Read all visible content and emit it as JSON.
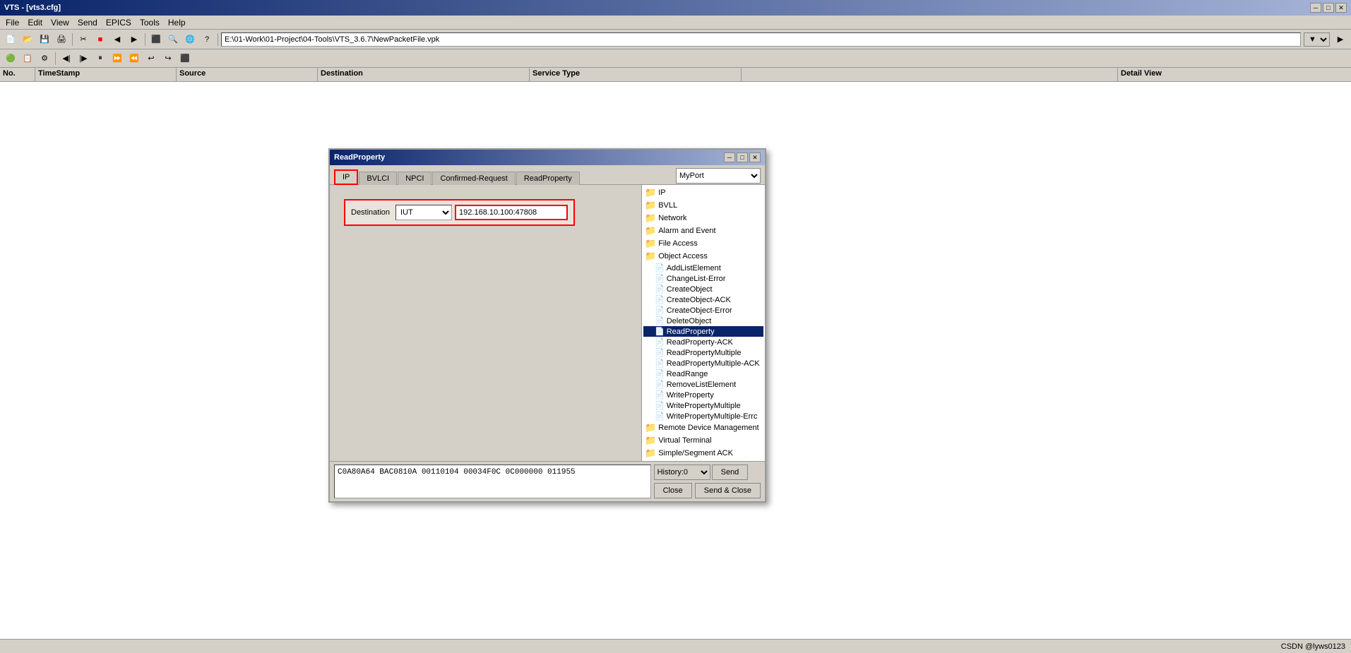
{
  "app": {
    "title": "VTS - [vts3.cfg]",
    "watermark": "CSDN @lyws0123"
  },
  "menu": {
    "items": [
      "File",
      "Edit",
      "View",
      "Send",
      "EPICS",
      "Tools",
      "Help"
    ]
  },
  "address_bar": {
    "path": "E:\\01-Work\\01-Project\\04-Tools\\VTS_3.6.7\\NewPacketFile.vpk"
  },
  "table": {
    "columns": [
      "No.",
      "TimeStamp",
      "Source",
      "Destination",
      "Service Type",
      "",
      "Detail View"
    ]
  },
  "dialog": {
    "title": "ReadProperty",
    "tabs": [
      "IP",
      "BVLCI",
      "NPCI",
      "Confirmed-Request",
      "ReadProperty"
    ],
    "active_tab": "IP",
    "destination": {
      "label": "Destination",
      "type": "IUT",
      "ip": "192.168.10.100:47808"
    },
    "port_select": "MyPort",
    "hex_content": "C0A80A64 BAC0810A 00110104 00034F0C 0C000000\n011955",
    "tree": {
      "items": [
        {
          "label": "IP",
          "type": "folder",
          "level": 0
        },
        {
          "label": "BVLL",
          "type": "folder",
          "level": 0
        },
        {
          "label": "Network",
          "type": "folder",
          "level": 0
        },
        {
          "label": "Alarm and Event",
          "type": "folder",
          "level": 0
        },
        {
          "label": "File Access",
          "type": "folder",
          "level": 0
        },
        {
          "label": "Object Access",
          "type": "folder",
          "level": 0,
          "expanded": true
        },
        {
          "label": "AddListElement",
          "type": "item",
          "level": 1
        },
        {
          "label": "ChangeList-Error",
          "type": "item",
          "level": 1
        },
        {
          "label": "CreateObject",
          "type": "item",
          "level": 1
        },
        {
          "label": "CreateObject-ACK",
          "type": "item",
          "level": 1
        },
        {
          "label": "CreateObject-Error",
          "type": "item",
          "level": 1
        },
        {
          "label": "DeleteObject",
          "type": "item",
          "level": 1
        },
        {
          "label": "ReadProperty",
          "type": "item",
          "level": 1,
          "selected": true
        },
        {
          "label": "ReadProperty-ACK",
          "type": "item",
          "level": 1
        },
        {
          "label": "ReadPropertyMultiple",
          "type": "item",
          "level": 1
        },
        {
          "label": "ReadPropertyMultiple-ACK",
          "type": "item",
          "level": 1
        },
        {
          "label": "ReadRange",
          "type": "item",
          "level": 1
        },
        {
          "label": "RemoveListElement",
          "type": "item",
          "level": 1
        },
        {
          "label": "WriteProperty",
          "type": "item",
          "level": 1
        },
        {
          "label": "WritePropertyMultiple",
          "type": "item",
          "level": 1
        },
        {
          "label": "WritePropertyMultiple-Errc",
          "type": "item",
          "level": 1
        },
        {
          "label": "Remote Device Management",
          "type": "folder",
          "level": 0
        },
        {
          "label": "Virtual Terminal",
          "type": "folder",
          "level": 0
        },
        {
          "label": "Simple/Segment ACK",
          "type": "folder",
          "level": 0
        }
      ]
    },
    "history": "History:0",
    "buttons": {
      "send": "Send",
      "close": "Close",
      "send_close": "Send & Close"
    }
  }
}
